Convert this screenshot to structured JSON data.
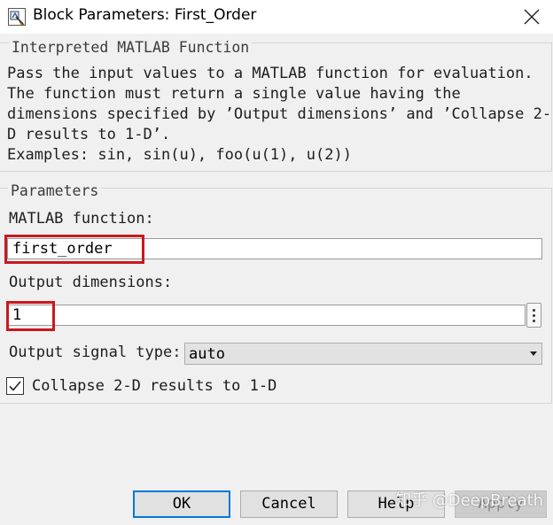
{
  "window": {
    "title": "Block Parameters: First_Order",
    "icon": "simulink-block-icon"
  },
  "description_group": {
    "legend": "Interpreted MATLAB Function",
    "lines": [
      "Pass the input values to a MATLAB function for evaluation.",
      "The function must return a single value having the",
      "dimensions specified by ’Output dimensions’ and ’Collapse 2-",
      "D results to 1-D’.",
      "Examples: sin, sin(u), foo(u(1), u(2))"
    ]
  },
  "parameters_group": {
    "legend": "Parameters",
    "matlab_function": {
      "label": "MATLAB function:",
      "value": "first_order"
    },
    "output_dimensions": {
      "label": "Output dimensions:",
      "value": "1"
    },
    "output_signal_type": {
      "label": "Output signal type:",
      "selected": "auto"
    },
    "collapse": {
      "label": "Collapse 2-D results to 1-D",
      "checked": true
    }
  },
  "buttons": {
    "ok": "OK",
    "cancel": "Cancel",
    "help": "Help",
    "apply": "Apply"
  },
  "watermark": "知乎 @DeepBreath",
  "colors": {
    "highlight": "#c8191f",
    "ok_border": "#0078d7"
  }
}
